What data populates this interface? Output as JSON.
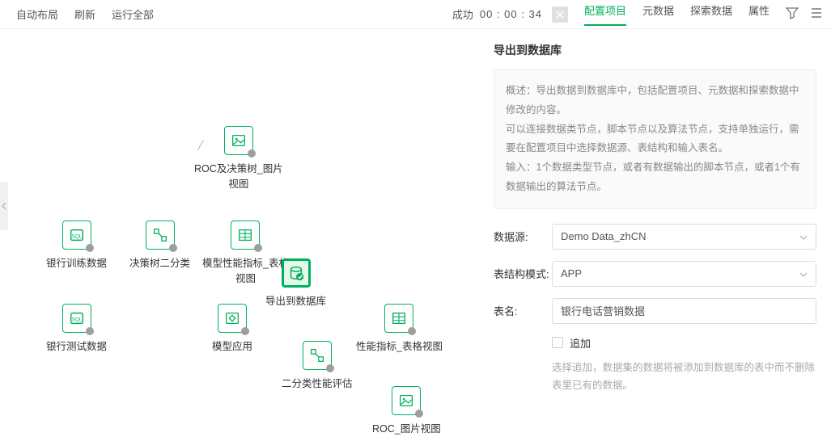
{
  "topbar": {
    "left": [
      "自动布局",
      "刷新",
      "运行全部"
    ],
    "status_label": "成功",
    "status_time": "00 : 00 : 34",
    "tabs": [
      {
        "label": "配置项目",
        "active": true
      },
      {
        "label": "元数据",
        "active": false
      },
      {
        "label": "探索数据",
        "active": false
      },
      {
        "label": "属性",
        "active": false
      }
    ]
  },
  "nodes": {
    "n1": "银行训练数据",
    "n2": "决策树二分类",
    "n3": "ROC及决策树_图片\n视图",
    "n4": "模型性能指标_表格\n视图",
    "n5": "导出到数据库",
    "n6": "银行测试数据",
    "n7": "模型应用",
    "n8": "性能指标_表格视图",
    "n9": "二分类性能评估",
    "n10": "ROC_图片视图"
  },
  "panel": {
    "title": "导出到数据库",
    "desc": {
      "line1": "概述：导出数据到数据库中，包括配置项目、元数据和探索数据中修改的内容。",
      "line2": "可以连接数据类节点，脚本节点以及算法节点，支持单独运行，需要在配置项目中选择数据源、表结构和输入表名。",
      "line3": "输入：1个数据类型节点，或者有数据输出的脚本节点，或者1个有数据输出的算法节点。"
    },
    "form": {
      "datasource_label": "数据源:",
      "datasource_value": "Demo Data_zhCN",
      "schema_label": "表结构模式:",
      "schema_value": "APP",
      "table_label": "表名:",
      "table_value": "银行电话营销数据",
      "append_label": "追加",
      "append_hint": "选择追加，数据集的数据将被添加到数据库的表中而不删除表里已有的数据。"
    }
  }
}
